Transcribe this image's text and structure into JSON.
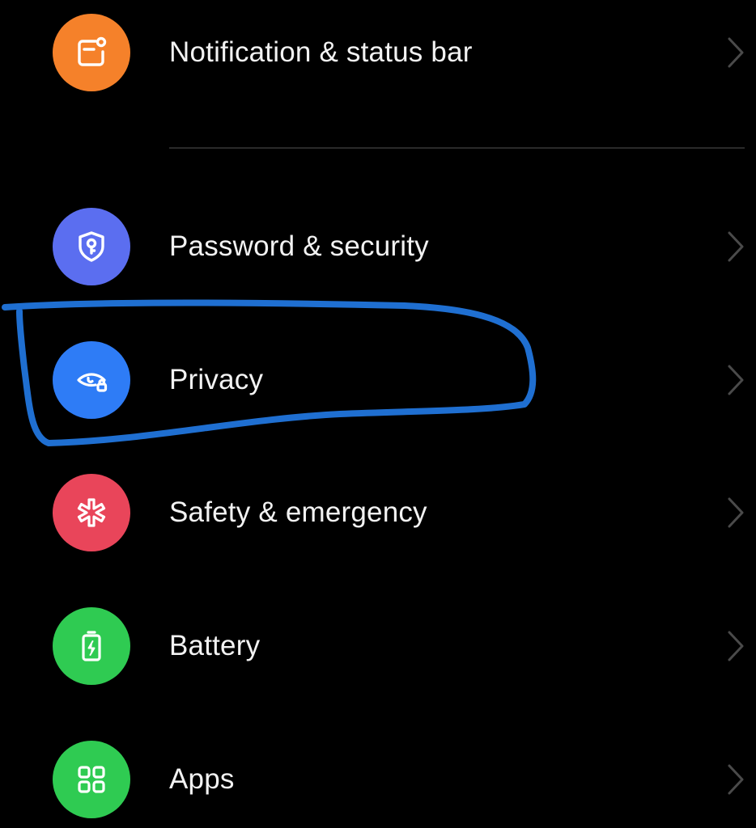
{
  "settings_list": {
    "items": [
      {
        "id": "notification",
        "label": "Notification & status bar",
        "icon": "notification-bar-icon",
        "color": "#F5812A"
      },
      {
        "id": "password",
        "label": "Password & security",
        "icon": "shield-key-icon",
        "color": "#5B6EF0"
      },
      {
        "id": "privacy",
        "label": "Privacy",
        "icon": "eye-lock-icon",
        "color": "#2E7CF6"
      },
      {
        "id": "safety",
        "label": "Safety & emergency",
        "icon": "asterisk-icon",
        "color": "#E9455A"
      },
      {
        "id": "battery",
        "label": "Battery",
        "icon": "battery-charging-icon",
        "color": "#2FCB52"
      },
      {
        "id": "apps",
        "label": "Apps",
        "icon": "apps-grid-icon",
        "color": "#2FCB52"
      }
    ]
  },
  "annotation": {
    "color": "#1F6FD1",
    "target": "Privacy"
  }
}
